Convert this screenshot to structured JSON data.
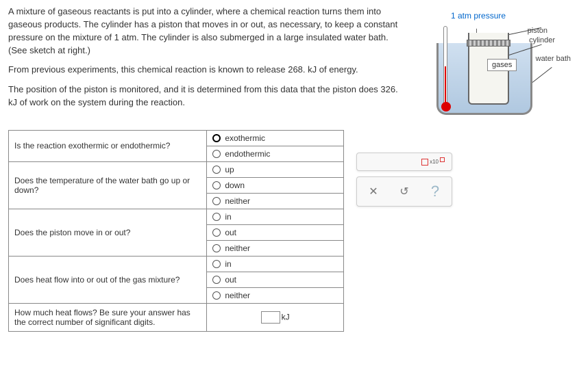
{
  "problem": {
    "p1": "A mixture of gaseous reactants is put into a cylinder, where a chemical reaction turns them into gaseous products. The cylinder has a piston that moves in or out, as necessary, to keep a constant pressure on the mixture of 1 atm. The cylinder is also submerged in a large insulated water bath. (See sketch at right.)",
    "p2": "From previous experiments, this chemical reaction is known to release 268. kJ of energy.",
    "p3": "The position of the piston is monitored, and it is determined from this data that the piston does 326. kJ of work on the system during the reaction."
  },
  "diagram": {
    "pressure": "1 atm pressure",
    "piston": "piston",
    "cylinder": "cylinder",
    "waterbath": "water bath",
    "gases": "gases"
  },
  "questions": [
    {
      "q": "Is the reaction exothermic or endothermic?",
      "type": "radio",
      "options": [
        "exothermic",
        "endothermic"
      ],
      "selected": 0
    },
    {
      "q": "Does the temperature of the water bath go up or down?",
      "type": "radio",
      "options": [
        "up",
        "down",
        "neither"
      ],
      "selected": -1
    },
    {
      "q": "Does the piston move in or out?",
      "type": "radio",
      "options": [
        "in",
        "out",
        "neither"
      ],
      "selected": -1
    },
    {
      "q": "Does heat flow into or out of the gas mixture?",
      "type": "radio",
      "options": [
        "in",
        "out",
        "neither"
      ],
      "selected": -1
    },
    {
      "q": "How much heat flows? Be sure your answer has the correct number of significant digits.",
      "type": "input",
      "unit": "kJ"
    }
  ],
  "toolbar": {
    "x10": "x10",
    "close": "✕",
    "reset": "↺",
    "help": "?"
  }
}
